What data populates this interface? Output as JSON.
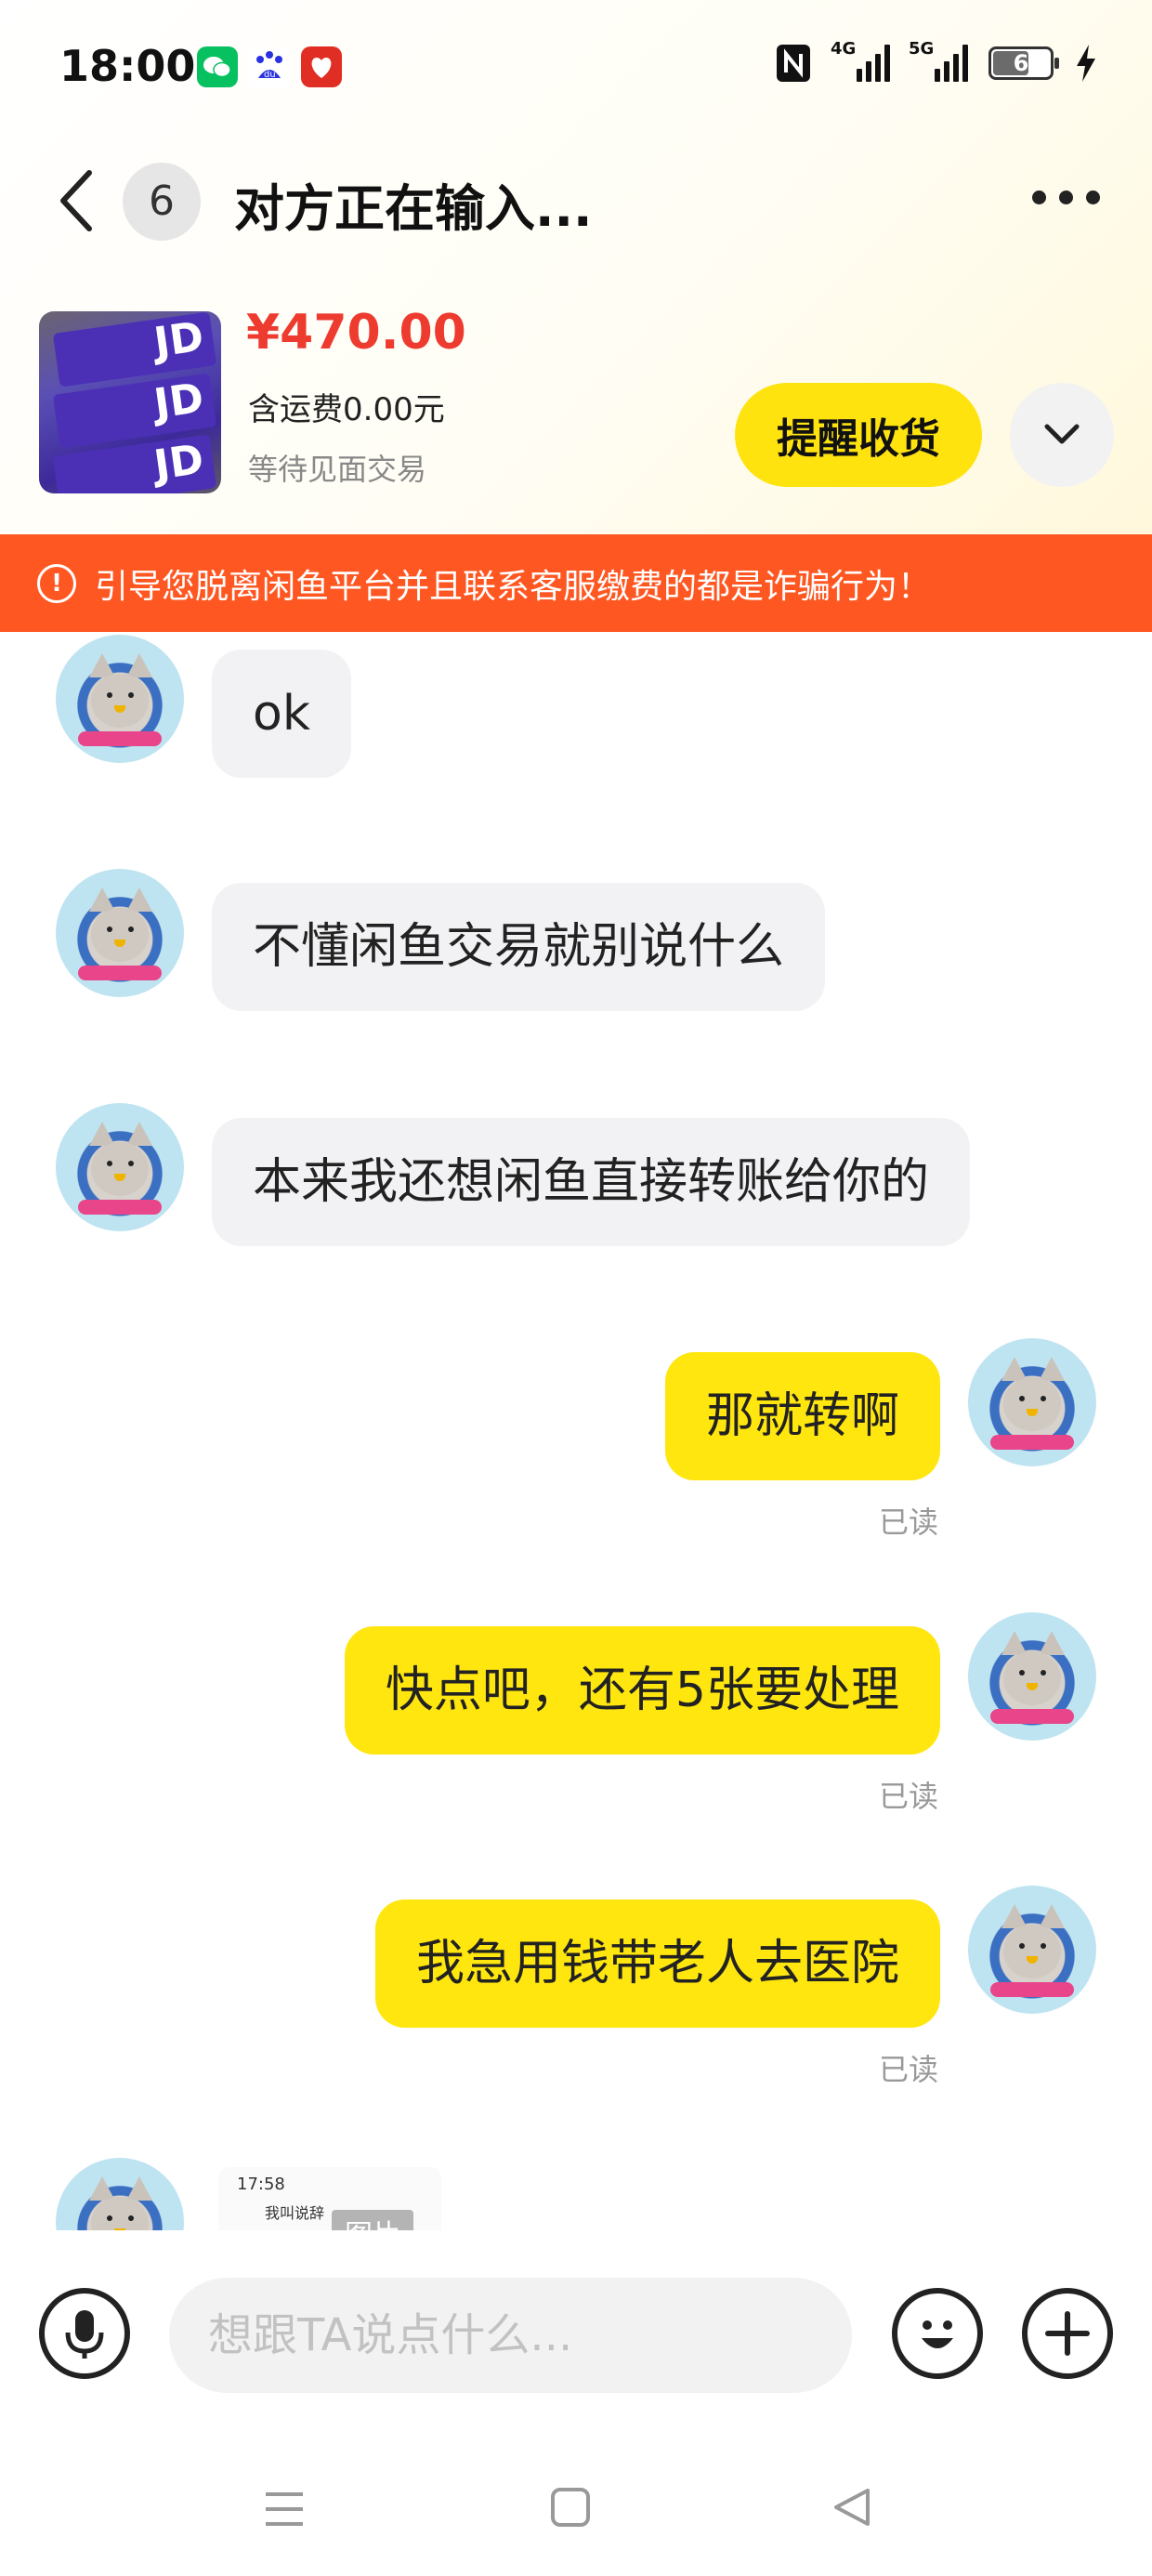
{
  "status_bar": {
    "time": "18:00",
    "app_icons": [
      "wechat-icon",
      "baidu-icon",
      "pinduoduo-icon"
    ],
    "signal_1_label": "4G",
    "signal_2_label": "5G",
    "battery_level": "6"
  },
  "header": {
    "unread_count": "6",
    "title": "对方正在输入..."
  },
  "product": {
    "price": "¥470.00",
    "shipping": "含运费0.00元",
    "status": "等待见面交易",
    "remind_button": "提醒收货"
  },
  "warning": {
    "text": "引导您脱离闲鱼平台并且联系客服缴费的都是诈骗行为！"
  },
  "messages": [
    {
      "direction": "in",
      "text": "ok"
    },
    {
      "direction": "in",
      "text": "不懂闲鱼交易就别说什么"
    },
    {
      "direction": "in",
      "text": "本来我还想闲鱼直接转账给你的"
    },
    {
      "direction": "out",
      "text": "那就转啊",
      "status": "已读"
    },
    {
      "direction": "out",
      "text": "快点吧，还有5张要处理",
      "status": "已读"
    },
    {
      "direction": "out",
      "text": "我急用钱带老人去医院",
      "status": "已读"
    },
    {
      "direction": "in",
      "type": "image",
      "label": "图片",
      "preview_time": "17:58",
      "preview_title": "我叫说辞"
    }
  ],
  "input_bar": {
    "placeholder": "想跟TA说点什么..."
  },
  "colors": {
    "accent_yellow": "#ffe60f",
    "warning_orange": "#ff5722",
    "price_red": "#ee3b2f"
  }
}
